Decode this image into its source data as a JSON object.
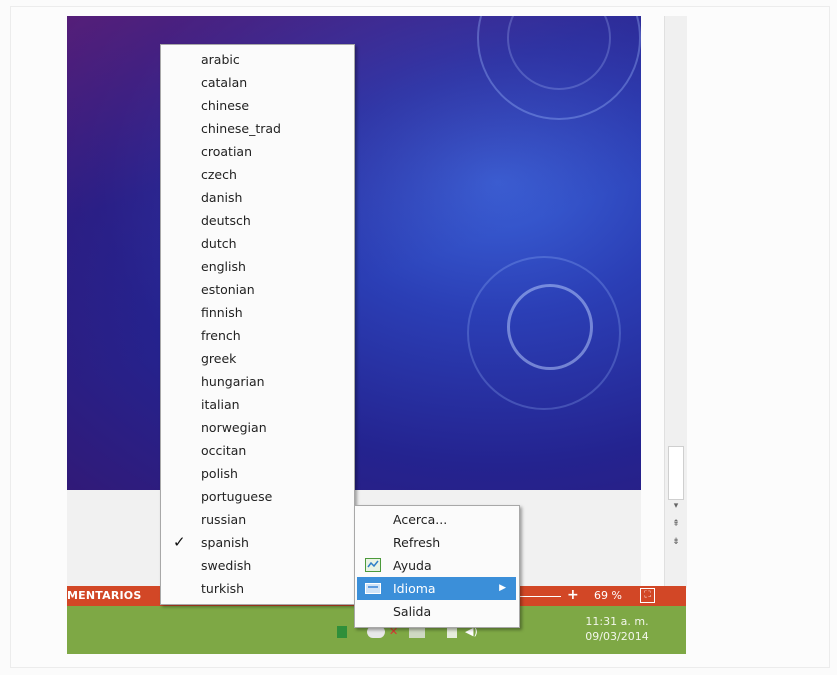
{
  "status_bar": {
    "comments_label": "MENTARIOS",
    "zoom_plus": "+",
    "zoom_value": "69 %"
  },
  "taskbar": {
    "time": "11:31 a. m.",
    "date": "09/03/2014"
  },
  "language_menu": {
    "items": [
      {
        "label": "arabic",
        "checked": false
      },
      {
        "label": "catalan",
        "checked": false
      },
      {
        "label": "chinese",
        "checked": false
      },
      {
        "label": "chinese_trad",
        "checked": false
      },
      {
        "label": "croatian",
        "checked": false
      },
      {
        "label": "czech",
        "checked": false
      },
      {
        "label": "danish",
        "checked": false
      },
      {
        "label": "deutsch",
        "checked": false
      },
      {
        "label": "dutch",
        "checked": false
      },
      {
        "label": "english",
        "checked": false
      },
      {
        "label": "estonian",
        "checked": false
      },
      {
        "label": "finnish",
        "checked": false
      },
      {
        "label": "french",
        "checked": false
      },
      {
        "label": "greek",
        "checked": false
      },
      {
        "label": "hungarian",
        "checked": false
      },
      {
        "label": "italian",
        "checked": false
      },
      {
        "label": "norwegian",
        "checked": false
      },
      {
        "label": "occitan",
        "checked": false
      },
      {
        "label": "polish",
        "checked": false
      },
      {
        "label": "portuguese",
        "checked": false
      },
      {
        "label": "russian",
        "checked": false
      },
      {
        "label": "spanish",
        "checked": true
      },
      {
        "label": "swedish",
        "checked": false
      },
      {
        "label": "turkish",
        "checked": false
      }
    ],
    "check_mark": "✓"
  },
  "context_menu": {
    "items": [
      {
        "label": "Acerca..."
      },
      {
        "label": "Refresh"
      },
      {
        "label": "Ayuda",
        "icon": "help-icon"
      },
      {
        "label": "Idioma",
        "icon": "language-icon",
        "highlighted": true,
        "submenu": true
      },
      {
        "label": "Salida"
      }
    ]
  },
  "colors": {
    "status_bar": "#d24726",
    "taskbar": "#7ea845",
    "menu_highlight": "#3b8fd9"
  }
}
